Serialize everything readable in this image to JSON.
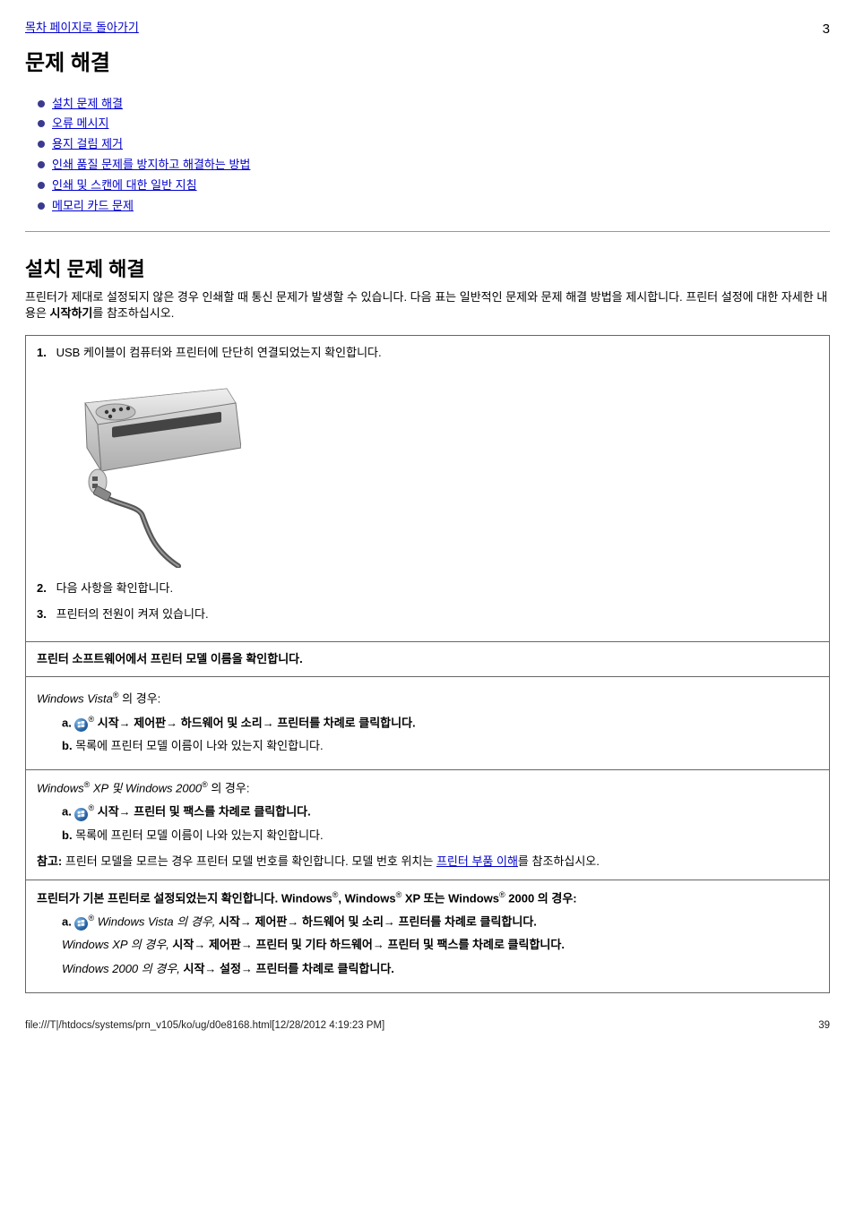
{
  "header": {
    "back_link": "목차 페이지로 돌아가기",
    "page_num_top": "3"
  },
  "title": "문제 해결",
  "toc": [
    "설치 문제 해결",
    "오류 메시지",
    "용지 걸림 제거",
    "인쇄 품질 문제를 방지하고 해결하는 방법",
    "인쇄 및 스캔에 대한 일반 지침",
    "메모리 카드 문제"
  ],
  "section": {
    "title": "설치 문제 해결",
    "lead_prefix": "프린터가 제대로 설정되지 않은 경우 인쇄할 때 통신 문제가 발생할 수 있습니다. 다음 표는 일반적인 문제와 문제 해결 방법을 제시합니다. 프린터 설정에 대한 자세한 내용은 ",
    "lead_link": "시작하기",
    "lead_suffix": "를 참조하십시오."
  },
  "table": {
    "step1": {
      "num": "1.",
      "text": "USB 케이블이 컴퓨터와 프린터에 단단히 연결되었는지 확인합니다."
    },
    "step2": {
      "num": "2.",
      "text": "다음 사항을 확인합니다."
    },
    "step3": {
      "num": "3.",
      "text": "프린터의 전원이 켜져 있습니다."
    },
    "header_cell": "프린터 소프트웨어에서 프린터 모델 이름을 확인합니다.",
    "check_vista": {
      "label_italic": "Windows Vista",
      "tail": "  의 경우:"
    },
    "sub_a_num": "a.",
    "sub_a_vista": "  시작→ 제어판→ 하드웨어 및 소리→ 프린터를 차례로 클릭합니다.",
    "sub_b_num": "b.",
    "sub_b_text": "목록에 프린터 모델 이름이 나와 있는지 확인합니다.",
    "check_xp2k": {
      "label_italic_1": "Windows",
      "label_italic_2": " XP 및 Windows 2000",
      "tail": "  의 경우:"
    },
    "sub_a_xp": "  시작→ 프린터 및 팩스를 차례로 클릭합니다.",
    "note_prefix": "참고:",
    "note_body": " 프린터 모델을 모르는 경우 프린터 모델 번호를 확인합니다. 모델 번호 위치는 ",
    "note_link": "프린터 부품 이해",
    "note_suffix": "를 참조하십시오.",
    "default_header": "프린터가 기본 프린터로 설정되었는지 확인합니다. Windows",
    "default_header_tail": ", Windows",
    "default_header_tail2": " XP 또는 Windows",
    "default_header_tail3": " 2000 의 경우:",
    "sub_a_default_vista": "  시작→ 제어판→ 하드웨어 및 소리→ 프린터를 차례로 클릭합니다.",
    "sub_a_default_vista_prefix": "Windows Vista 의 경우, ",
    "sub_a_default_xp_prefix": "Windows XP 의 경우, ",
    "sub_a_default_xp": "시작→ 제어판→ 프린터 및 기타 하드웨어→ 프린터 및 팩스를 차례로 클릭합니다.",
    "sub_a_default_2k_prefix": "Windows 2000 의 경우, ",
    "sub_a_default_2k": "시작→ 설정→ 프린터를 차례로 클릭합니다."
  },
  "footer": {
    "path": "file:///T|/htdocs/systems/prn_v105/ko/ug/d0e8168.html[12/28/2012 4:19:23 PM]",
    "num": "39"
  }
}
